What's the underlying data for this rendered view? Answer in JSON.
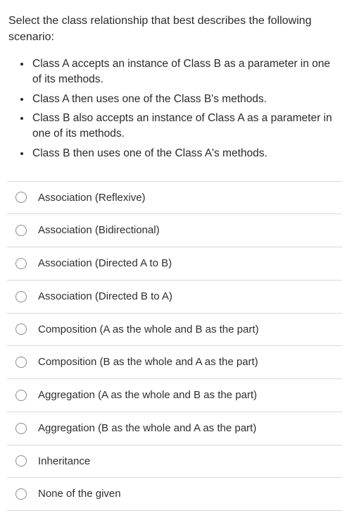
{
  "question": "Select the class relationship that best describes the following scenario:",
  "scenario": [
    "Class A accepts an instance of Class B as a parameter in one of its methods.",
    "Class A then uses one of the Class B's methods.",
    "Class B also accepts an instance of Class A as a parameter in one of its methods.",
    "Class B then uses one of the Class A's methods."
  ],
  "options": [
    "Association (Reflexive)",
    "Association (Bidirectional)",
    "Association (Directed A to B)",
    "Association (Directed B to A)",
    "Composition (A as the whole and B as the part)",
    "Composition (B as the whole and A as the part)",
    "Aggregation (A as the whole and B as the part)",
    "Aggregation (B as the whole and A as the part)",
    "Inheritance",
    "None of the given"
  ]
}
